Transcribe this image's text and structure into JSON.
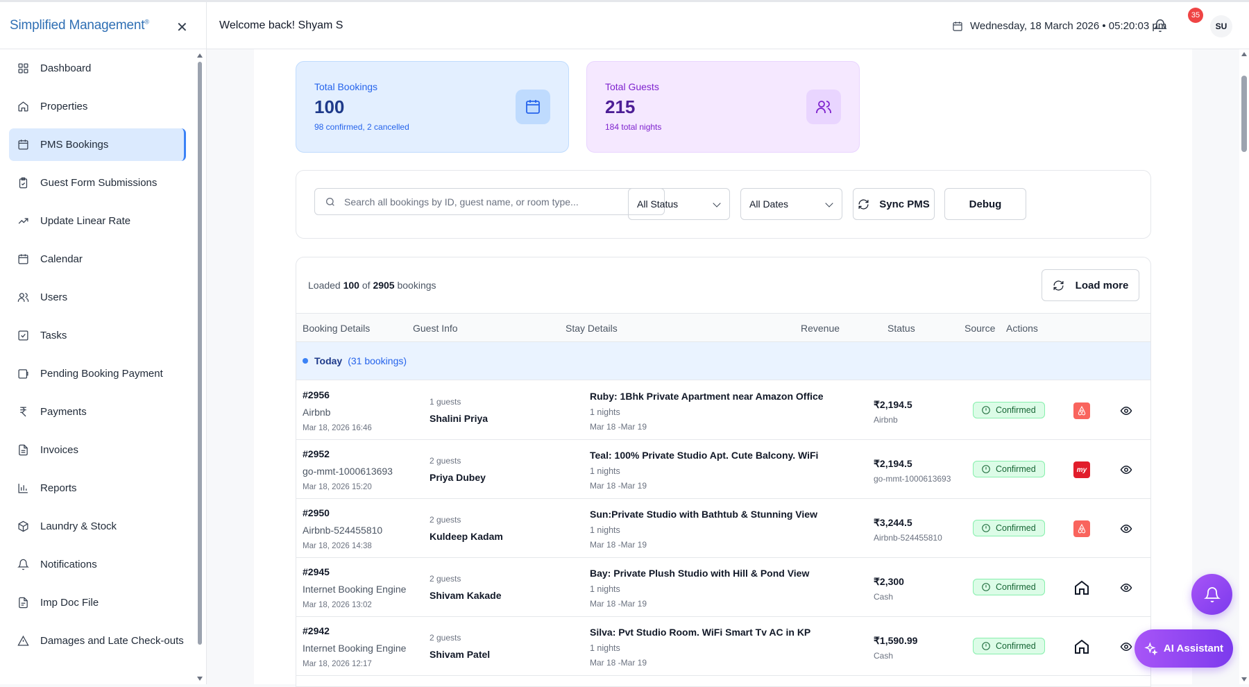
{
  "app": {
    "title": "Simplified Management",
    "trademark": "®"
  },
  "header": {
    "welcome": "Welcome back! Shyam S",
    "datetime": "Wednesday, 18 March 2026 • 05:20:03 pm",
    "notification_count": "35",
    "avatar_initials": "SU"
  },
  "sidebar": {
    "items": [
      {
        "label": "Dashboard",
        "icon": "dashboard-icon"
      },
      {
        "label": "Properties",
        "icon": "home-icon"
      },
      {
        "label": "PMS Bookings",
        "icon": "calendar-icon",
        "active": true
      },
      {
        "label": "Guest Form Submissions",
        "icon": "clipboard-check-icon"
      },
      {
        "label": "Update Linear Rate",
        "icon": "trending-up-icon"
      },
      {
        "label": "Calendar",
        "icon": "calendar-icon"
      },
      {
        "label": "Users",
        "icon": "users-icon"
      },
      {
        "label": "Tasks",
        "icon": "checkbox-icon"
      },
      {
        "label": "Pending Booking Payment",
        "icon": "wallet-icon"
      },
      {
        "label": "Payments",
        "icon": "rupee-icon"
      },
      {
        "label": "Invoices",
        "icon": "document-icon"
      },
      {
        "label": "Reports",
        "icon": "bar-chart-icon"
      },
      {
        "label": "Laundry & Stock",
        "icon": "package-icon"
      },
      {
        "label": "Notifications",
        "icon": "bell-icon"
      },
      {
        "label": "Imp Doc File",
        "icon": "file-icon"
      },
      {
        "label": "Damages and Late Check-outs",
        "icon": "warning-icon"
      }
    ]
  },
  "stats": {
    "bookings": {
      "label": "Total Bookings",
      "value": "100",
      "sub": "98 confirmed, 2 cancelled"
    },
    "guests": {
      "label": "Total Guests",
      "value": "215",
      "sub": "184 total nights"
    }
  },
  "filters": {
    "search_placeholder": "Search all bookings by ID, guest name, or room type...",
    "status": "All Status",
    "dates": "All Dates",
    "sync_label": "Sync PMS",
    "debug_label": "Debug"
  },
  "table": {
    "loaded_prefix": "Loaded",
    "loaded_count": "100",
    "loaded_of": "of",
    "loaded_total": "2905",
    "loaded_suffix": "bookings",
    "load_more_label": "Load more",
    "columns": [
      "Booking Details",
      "Guest Info",
      "Stay Details",
      "Revenue",
      "Status",
      "Source",
      "Actions"
    ],
    "group": {
      "label": "Today",
      "count": "(31 bookings)"
    },
    "rows": [
      {
        "id": "#2956",
        "channel": "Airbnb",
        "datetime": "Mar 18, 2026 16:46",
        "guests": "1 guests",
        "name": "Shalini Priya",
        "property": "Ruby: 1Bhk Private Apartment near Amazon Office",
        "nights": "1 nights",
        "range": "Mar 18 -Mar 19",
        "revenue": "₹2,194.5",
        "revenue_source": "Airbnb",
        "status": "Confirmed",
        "source_icon": "airbnb-icon"
      },
      {
        "id": "#2952",
        "channel": "go-mmt-1000613693",
        "datetime": "Mar 18, 2026 15:20",
        "guests": "2 guests",
        "name": "Priya Dubey",
        "property": "Teal: 100% Private Studio Apt. Cute Balcony. WiFi",
        "nights": "1 nights",
        "range": "Mar 18 -Mar 19",
        "revenue": "₹2,194.5",
        "revenue_source": "go-mmt-1000613693",
        "status": "Confirmed",
        "source_icon": "makemytrip-icon"
      },
      {
        "id": "#2950",
        "channel": "Airbnb-524455810",
        "datetime": "Mar 18, 2026 14:38",
        "guests": "2 guests",
        "name": "Kuldeep Kadam",
        "property": "Sun:Private Studio with Bathtub & Stunning View",
        "nights": "1 nights",
        "range": "Mar 18 -Mar 19",
        "revenue": "₹3,244.5",
        "revenue_source": "Airbnb-524455810",
        "status": "Confirmed",
        "source_icon": "airbnb-icon"
      },
      {
        "id": "#2945",
        "channel": "Internet Booking Engine",
        "datetime": "Mar 18, 2026 13:02",
        "guests": "2 guests",
        "name": "Shivam Kakade",
        "property": "Bay: Private Plush Studio with Hill & Pond View",
        "nights": "1 nights",
        "range": "Mar 18 -Mar 19",
        "revenue": "₹2,300",
        "revenue_source": "Cash",
        "status": "Confirmed",
        "source_icon": "home-icon"
      },
      {
        "id": "#2942",
        "channel": "Internet Booking Engine",
        "datetime": "Mar 18, 2026 12:17",
        "guests": "2 guests",
        "name": "Shivam Patel",
        "property": "Silva: Pvt Studio Room. WiFi Smart Tv AC in KP",
        "nights": "1 nights",
        "range": "Mar 18 -Mar 19",
        "revenue": "₹1,590.99",
        "revenue_source": "Cash",
        "status": "Confirmed",
        "source_icon": "home-icon"
      }
    ]
  },
  "floating": {
    "ai_label": "AI Assistant"
  },
  "colors": {
    "accent": "#3b82f6",
    "brand": "#2f6fb4",
    "confirmed": "#166534",
    "purple": "#7c3aed"
  }
}
